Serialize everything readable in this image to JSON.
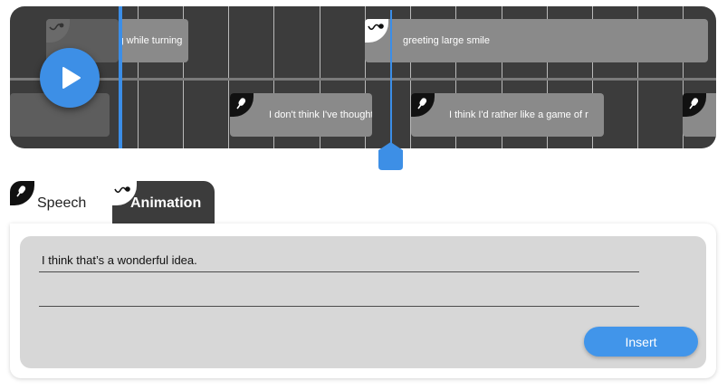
{
  "timeline": {
    "clips": [
      {
        "id": "c1",
        "text": "laughing while turning",
        "dim": false,
        "badge": "animation"
      },
      {
        "id": "c2",
        "text": "greeting large smile",
        "dim": false,
        "badge": "animation"
      },
      {
        "id": "c3",
        "text": "I don't think I've thought",
        "dim": false,
        "badge": "speech"
      },
      {
        "id": "c4",
        "text": "I think I'd rather like a game of r",
        "dim": false,
        "badge": "speech"
      }
    ],
    "play_icon": "play-icon",
    "accent_color": "#3b8ee8"
  },
  "tabs": {
    "speech_label": "Speech",
    "animation_label": "Animation",
    "active": "Speech"
  },
  "form": {
    "line1_value": "I think that’s a wonderful idea.",
    "line2_value": "",
    "insert_label": "Insert"
  },
  "icons": {
    "speech": "microphone-icon",
    "animation": "animation-curve-icon"
  }
}
